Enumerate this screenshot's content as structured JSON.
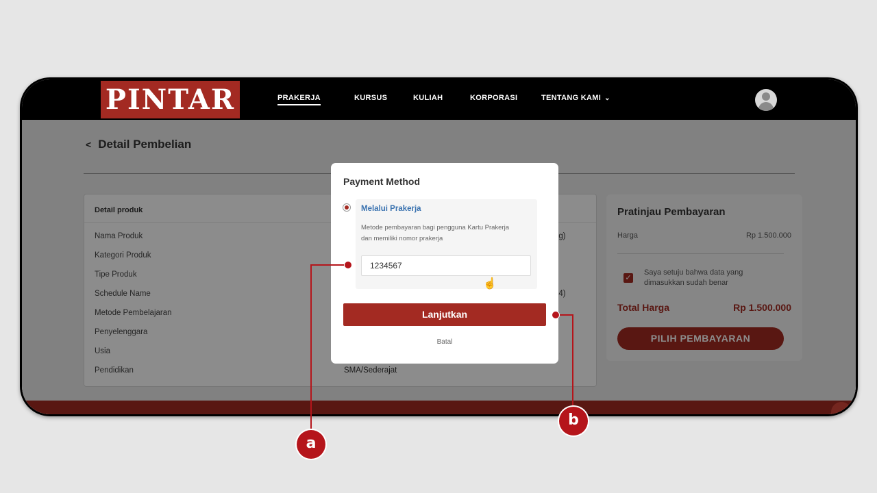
{
  "navbar": {
    "logo": "PINTAR",
    "items": [
      {
        "label": "PRAKERJA",
        "active": true
      },
      {
        "label": "KURSUS"
      },
      {
        "label": "KULIAH"
      },
      {
        "label": "KORPORASI"
      },
      {
        "label": "TENTANG KAMI"
      }
    ]
  },
  "page": {
    "back_title": "Detail Pembelian",
    "detail": {
      "header": "Detail produk",
      "rows": [
        {
          "label": "Nama Produk",
          "value": "ng)"
        },
        {
          "label": "Kategori Produk",
          "value": ""
        },
        {
          "label": "Tipe Produk",
          "value": ""
        },
        {
          "label": "Schedule Name",
          "value": "24)"
        },
        {
          "label": "Metode Pembelajaran",
          "value": ""
        },
        {
          "label": "Penyelenggara",
          "value": ""
        },
        {
          "label": "Usia",
          "value": ""
        },
        {
          "label": "Pendidikan",
          "value": "SMA/Sederajat"
        }
      ]
    },
    "summary": {
      "title": "Pratinjau Pembayaran",
      "price_label": "Harga",
      "price_value": "Rp 1.500.000",
      "agree_text": "Saya setuju bahwa data yang dimasukkan sudah benar",
      "total_label": "Total Harga",
      "total_value": "Rp 1.500.000",
      "button": "PILIH PEMBAYARAN"
    }
  },
  "modal": {
    "title": "Payment Method",
    "option_title": "Melalui Prakerja",
    "option_desc": "Metode pembayaran bagi pengguna Kartu Prakerja dan memiliki nomor prakerja",
    "input_value": "1234567",
    "continue": "Lanjutkan",
    "cancel": "Batal"
  },
  "callouts": {
    "a": "a",
    "b": "b"
  },
  "colors": {
    "brand": "#a32a22",
    "callout": "#b5151b",
    "link": "#3b73b0"
  }
}
